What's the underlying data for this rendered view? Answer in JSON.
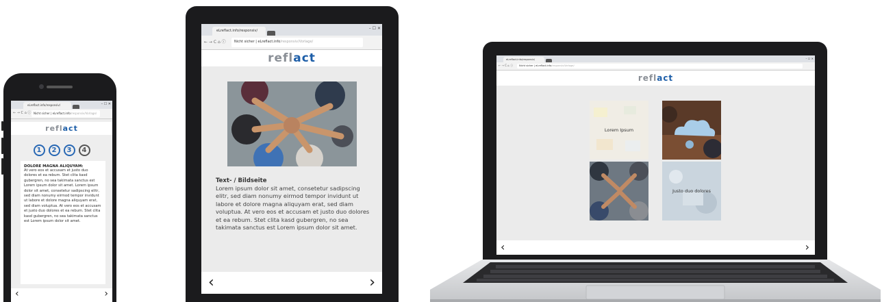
{
  "logo": {
    "part1": "refl",
    "part2": "act"
  },
  "browser": {
    "tab_title": "eLreflact.info/responsiv/",
    "window_controls": "–   ☐   ✕",
    "nav_glyphs": "←  →  C  ⌂  ⓘ",
    "security": "Nicht sicher",
    "url_domain": "eLreflact.info",
    "url_path": "/responsiv/Vorlage/"
  },
  "phone": {
    "steps": [
      "1",
      "2",
      "3",
      "4"
    ],
    "heading": "DOLORE MAGNA ALIQUYAM:",
    "body": "At vero eos et accusam et justo duo dolores et ea rebum. Stet clita kasd gubergren, no sea takimata sanctus est Lorem ipsum dolor sit amet. Lorem ipsum dolor sit amet, consetetur sadipscing elitr, sed diam nonumy eirmod tempor invidunt ut labore et dolore magna aliquyam erat, sed diam voluptua. At vero eos et accusam et justo duo dolores et ea rebum. Stet clita kasd gubergren, no sea takimata sanctus est Lorem ipsum dolor sit amet.",
    "prev": "‹",
    "next": "›"
  },
  "tablet": {
    "title": "Text- / Bildseite",
    "body": "Lorem ipsum dolor sit amet, consetetur sadipscing elitr, sed diam nonumy eirmod tempor invidunt ut labore et dolore magna aliquyam erat, sed diam voluptua. At vero eos et accusam et justo duo dolores et ea rebum. Stet clita kasd gubergren, no sea takimata sanctus est Lorem ipsum dolor sit amet.",
    "prev": "‹",
    "next": "›"
  },
  "laptop": {
    "tiles": [
      {
        "label": "Lorem Ipsum"
      },
      {
        "label": ""
      },
      {
        "label": ""
      },
      {
        "label": "Justo duo dolores"
      }
    ],
    "prev": "‹",
    "next": "›"
  },
  "colors": {
    "brand_blue": "#1d5ea8",
    "brand_grey": "#8a8f96",
    "step_blue": "#2868b4"
  },
  "icons": [
    "lock-icon",
    "back-icon",
    "forward-icon",
    "reload-icon",
    "home-icon",
    "star-icon",
    "menu-icon"
  ]
}
